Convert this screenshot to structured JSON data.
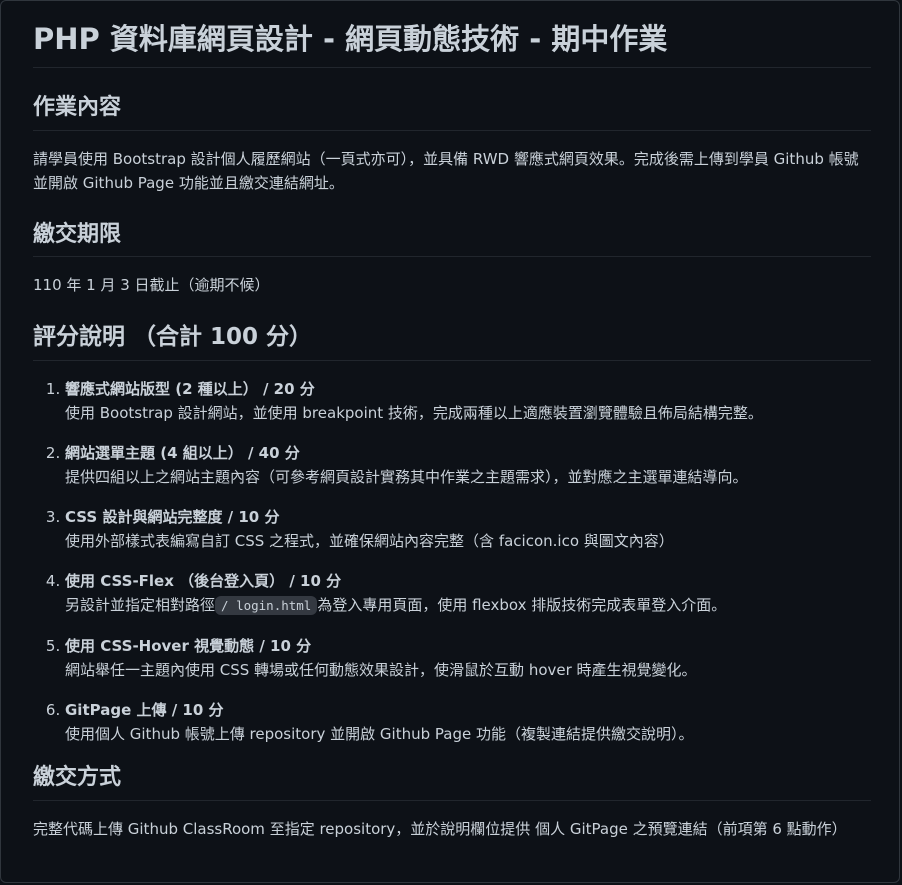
{
  "title": "PHP 資料庫網頁設計 - 網頁動態技術 - 期中作業",
  "sections": {
    "content": {
      "heading": "作業內容",
      "text": "請學員使用 Bootstrap 設計個人履歷網站（一頁式亦可），並具備 RWD 響應式網頁效果。完成後需上傳到學員 Github 帳號並開啟 Github Page 功能並且繳交連結網址。"
    },
    "deadline": {
      "heading": "繳交期限",
      "text": "110 年 1 月 3 日截止（逾期不候）"
    },
    "grading": {
      "heading": "評分說明 （合計 100 分）",
      "items": [
        {
          "title": "響應式網站版型 (2 種以上） / 20 分",
          "desc": "使用 Bootstrap 設計網站，並使用 breakpoint 技術，完成兩種以上適應裝置瀏覽體驗且佈局結構完整。"
        },
        {
          "title": "網站選單主題 (4 組以上） / 40 分",
          "desc": "提供四組以上之網站主題內容（可參考網頁設計實務其中作業之主題需求），並對應之主選單連結導向。"
        },
        {
          "title": "CSS 設計與網站完整度 / 10 分",
          "desc": "使用外部樣式表編寫自訂 CSS 之程式，並確保網站內容完整（含 facicon.ico 與圖文內容）"
        },
        {
          "title": "使用 CSS-Flex （後台登入頁） / 10 分",
          "desc_before": "另設計並指定相對路徑",
          "code": "/ login.html",
          "desc_after": "為登入專用頁面，使用 flexbox 排版技術完成表單登入介面。"
        },
        {
          "title": "使用 CSS-Hover 視覺動態 / 10 分",
          "desc": "網站舉任一主題內使用 CSS 轉場或任何動態效果設計，使滑鼠於互動 hover 時產生視覺變化。"
        },
        {
          "title": "GitPage 上傳 / 10 分",
          "desc": "使用個人 Github 帳號上傳 repository 並開啟 Github Page 功能（複製連結提供繳交說明）。"
        }
      ]
    },
    "submission": {
      "heading": "繳交方式",
      "text": "完整代碼上傳 Github ClassRoom 至指定 repository，並於說明欄位提供 個人 GitPage 之預覽連結（前項第 6 點動作）"
    }
  },
  "colors": {
    "background": "#0d1117",
    "text": "#c9d1d9",
    "divider": "#21262d",
    "code_bg": "#343941"
  }
}
